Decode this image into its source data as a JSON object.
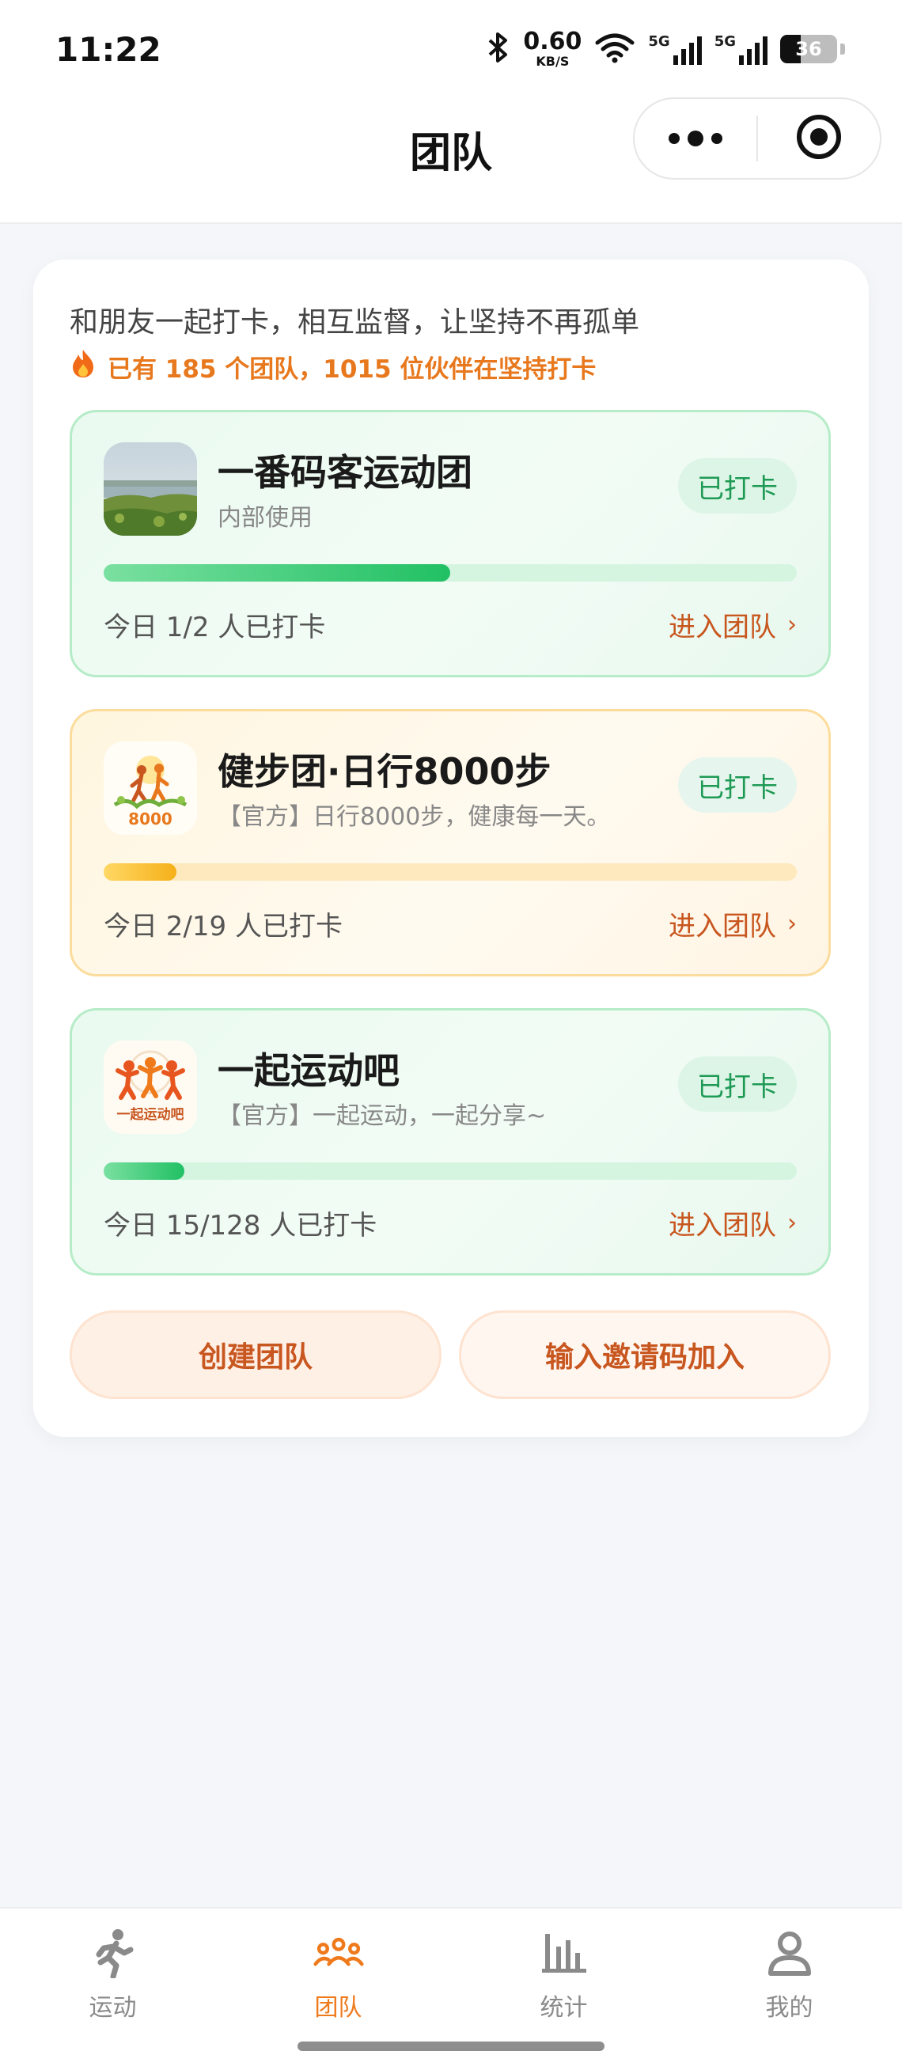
{
  "status_bar": {
    "time": "11:22",
    "net_speed_value": "0.60",
    "net_speed_unit": "KB/S",
    "signal_1": "5G",
    "signal_2": "5G",
    "battery": "36"
  },
  "nav": {
    "title": "团队",
    "more_icon": "more-dots-icon",
    "close_icon": "target-circle-icon"
  },
  "intro": {
    "text": "和朋友一起打卡，相互监督，让坚持不再孤单",
    "stats_icon": "fire-icon",
    "stats_text": "已有 185 个团队，1015 位伙伴在坚持打卡"
  },
  "teams": [
    {
      "name": "一番码客运动团",
      "desc": "内部使用",
      "status": "已打卡",
      "today": "今日 1/2 人已打卡",
      "progress": 0.5,
      "enter": "进入团队",
      "theme": "green",
      "avatar": "lakeside-photo"
    },
    {
      "name": "健步团·日行8000步",
      "desc": "【官方】日行8000步，健康每一天。",
      "status": "已打卡",
      "today": "今日 2/19 人已打卡",
      "progress": 0.105,
      "enter": "进入团队",
      "theme": "yellow",
      "avatar": "walkers-8000",
      "avatar_text": "8000"
    },
    {
      "name": "一起运动吧",
      "desc": "【官方】一起运动，一起分享~",
      "status": "已打卡",
      "today": "今日 15/128 人已打卡",
      "progress": 0.117,
      "enter": "进入团队",
      "theme": "green",
      "avatar": "runners-logo",
      "avatar_text": "一起运动吧"
    }
  ],
  "actions": {
    "create": "创建团队",
    "invite": "输入邀请码加入"
  },
  "tabs": [
    {
      "label": "运动",
      "icon": "running-person-icon",
      "active": false
    },
    {
      "label": "团队",
      "icon": "team-group-icon",
      "active": true
    },
    {
      "label": "统计",
      "icon": "bar-stats-icon",
      "active": false
    },
    {
      "label": "我的",
      "icon": "user-profile-icon",
      "active": false
    }
  ],
  "colors": {
    "accent": "#ef7a1c",
    "link": "#c8561f",
    "checked_green": "#1e9a55",
    "stats_orange": "#e8781d"
  }
}
